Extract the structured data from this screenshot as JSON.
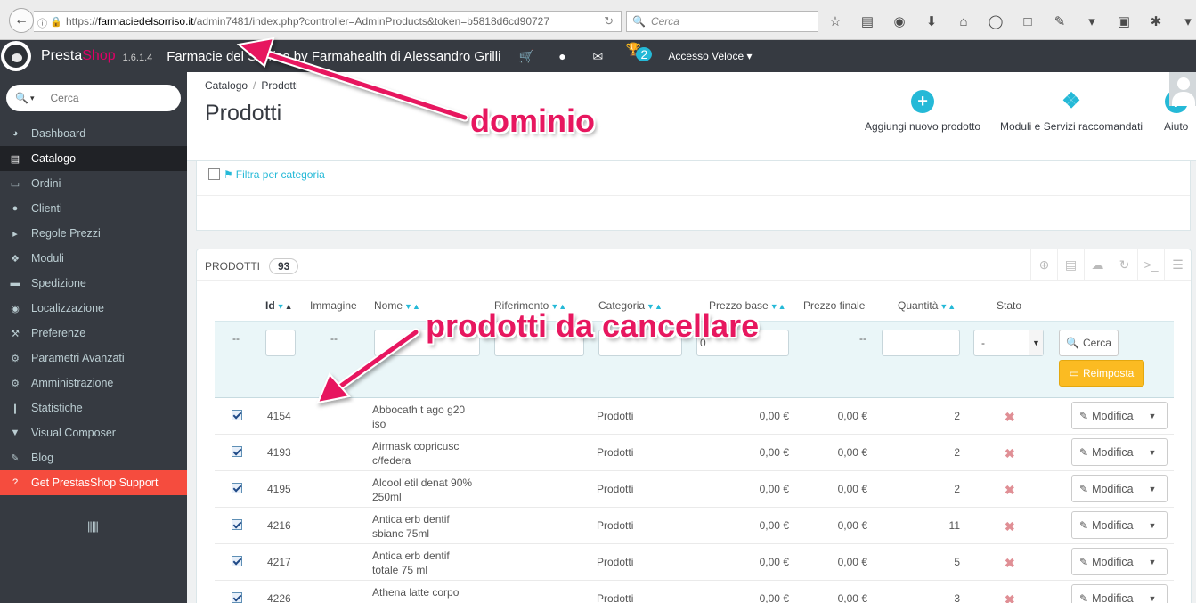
{
  "browser": {
    "url_prefix": "https://",
    "url_host": "farmaciedelsorriso.it",
    "url_path": "/admin7481/index.php?controller=AdminProducts&token=b5818d6cd90727",
    "search_placeholder": "Cerca"
  },
  "header": {
    "brand_presta": "Presta",
    "brand_shop": "Shop",
    "version": "1.6.1.4",
    "shop_name": "Farmacie del Sorriso by Farmahealth di Alessandro Grilli",
    "notification_count": "2",
    "quick_access": "Accesso Veloce"
  },
  "sidebar": {
    "search_placeholder": "Cerca",
    "items": [
      {
        "label": "Dashboard",
        "icon": "dashboard-icon"
      },
      {
        "label": "Catalogo",
        "icon": "book-icon"
      },
      {
        "label": "Ordini",
        "icon": "credit-card-icon"
      },
      {
        "label": "Clienti",
        "icon": "users-icon"
      },
      {
        "label": "Regole Prezzi",
        "icon": "tags-icon"
      },
      {
        "label": "Moduli",
        "icon": "puzzle-icon"
      },
      {
        "label": "Spedizione",
        "icon": "truck-icon"
      },
      {
        "label": "Localizzazione",
        "icon": "globe-icon"
      },
      {
        "label": "Preferenze",
        "icon": "wrench-icon"
      },
      {
        "label": "Parametri Avanzati",
        "icon": "cogs-icon"
      },
      {
        "label": "Amministrazione",
        "icon": "gear-icon"
      },
      {
        "label": "Statistiche",
        "icon": "bar-chart-icon"
      },
      {
        "label": "Visual Composer",
        "icon": "vc-icon"
      },
      {
        "label": "Blog",
        "icon": "edit-icon"
      },
      {
        "label": "Get PrestasShop Support",
        "icon": "question-icon"
      }
    ]
  },
  "page": {
    "breadcrumb_1": "Catalogo",
    "breadcrumb_sep": "/",
    "breadcrumb_2": "Prodotti",
    "title": "Prodotti",
    "add_product": "Aggiungi nuovo prodotto",
    "modules_services": "Moduli e Servizi raccomandati",
    "help": "Aiuto",
    "filter_by_category": "Filtra per categoria"
  },
  "products": {
    "heading": "PRODOTTI",
    "count": "93",
    "columns": {
      "id": "Id",
      "image": "Immagine",
      "name": "Nome",
      "reference": "Riferimento",
      "category": "Categoria",
      "base_price": "Prezzo base",
      "final_price": "Prezzo finale",
      "quantity": "Quantità",
      "status": "Stato"
    },
    "filters": {
      "dash": "--",
      "base_price_value": "0",
      "status_value": "-",
      "search_label": "Cerca",
      "reset_label": "Reimposta"
    },
    "edit_label": "Modifica",
    "rows": [
      {
        "id": "4154",
        "name": "Abbocath t ago g20 iso",
        "category": "Prodotti",
        "base_price": "0,00 €",
        "final_price": "0,00 €",
        "quantity": "2"
      },
      {
        "id": "4193",
        "name": "Airmask copricusc c/federa",
        "category": "Prodotti",
        "base_price": "0,00 €",
        "final_price": "0,00 €",
        "quantity": "2"
      },
      {
        "id": "4195",
        "name": "Alcool etil denat 90% 250ml",
        "category": "Prodotti",
        "base_price": "0,00 €",
        "final_price": "0,00 €",
        "quantity": "2"
      },
      {
        "id": "4216",
        "name": "Antica erb dentif sbianc 75ml",
        "category": "Prodotti",
        "base_price": "0,00 €",
        "final_price": "0,00 €",
        "quantity": "11"
      },
      {
        "id": "4217",
        "name": "Antica erb dentif totale 75 ml",
        "category": "Prodotti",
        "base_price": "0,00 €",
        "final_price": "0,00 €",
        "quantity": "5"
      },
      {
        "id": "4226",
        "name": "Athena latte corpo",
        "category": "Prodotti",
        "base_price": "0,00 €",
        "final_price": "0,00 €",
        "quantity": "3"
      }
    ]
  },
  "annotations": {
    "domain_label": "dominio",
    "delete_label": "prodotti da cancellare",
    "color": "#e7175f"
  }
}
